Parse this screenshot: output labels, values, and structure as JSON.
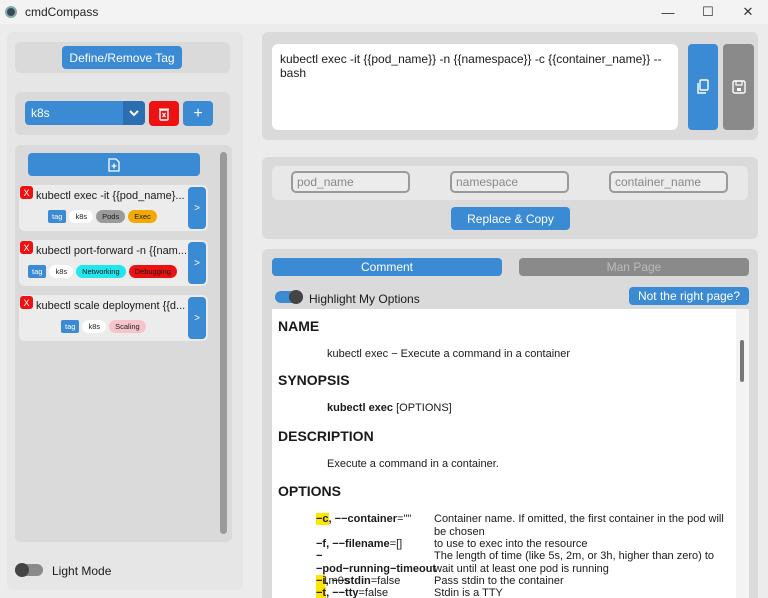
{
  "window": {
    "title": "cmdCompass",
    "minimize": "—",
    "maximize": "☐",
    "close": "✕"
  },
  "left": {
    "define_label": "Define/Remove Tag",
    "selected_tag": "k8s",
    "add_label": "+",
    "commands": [
      {
        "x": "X",
        "text": "kubectl exec -it {{pod_name}...",
        "open": ">",
        "tags": [
          {
            "label": "tag",
            "style": "label"
          },
          {
            "label": "k8s",
            "bg": "#ffffff",
            "fg": "#333333"
          },
          {
            "label": "Pods",
            "bg": "#9a9a9a",
            "fg": "#222222"
          },
          {
            "label": "Exec",
            "bg": "#f2a900",
            "fg": "#222222"
          }
        ]
      },
      {
        "x": "X",
        "text": "kubectl port-forward -n {{nam...",
        "open": ">",
        "tags": [
          {
            "label": "tag",
            "style": "label"
          },
          {
            "label": "k8s",
            "bg": "#ffffff",
            "fg": "#333333"
          },
          {
            "label": "Networking",
            "bg": "#22e5ee",
            "fg": "#222222"
          },
          {
            "label": "Debugging",
            "bg": "#ee1111",
            "fg": "#222222"
          }
        ]
      },
      {
        "x": "X",
        "text": "kubectl scale deployment {{d...",
        "open": ">",
        "tags": [
          {
            "label": "tag",
            "style": "label"
          },
          {
            "label": "k8s",
            "bg": "#ffffff",
            "fg": "#333333"
          },
          {
            "label": "Scaling",
            "bg": "#f8c4cc",
            "fg": "#333333"
          }
        ]
      }
    ],
    "light_mode_label": "Light Mode"
  },
  "command_text": "kubectl exec -it {{pod_name}} -n {{namespace}} -c {{container_name}} -- bash",
  "params": [
    {
      "placeholder": "pod_name"
    },
    {
      "placeholder": "namespace"
    },
    {
      "placeholder": "container_name"
    }
  ],
  "replace_label": "Replace & Copy",
  "tabs": {
    "comment": "Comment",
    "man": "Man Page"
  },
  "highlight_label": "Highlight My Options",
  "not_right_label": "Not the right page?",
  "man": {
    "name_h": "NAME",
    "name_text": "kubectl exec − Execute a command in a container",
    "synopsis_h": "SYNOPSIS",
    "synopsis_cmd": "kubectl exec",
    "synopsis_rest": " [OPTIONS]",
    "description_h": "DESCRIPTION",
    "description_text": "Execute a command in a container.",
    "options_h": "OPTIONS",
    "options": [
      {
        "hl": "−c",
        "flag": ", −−container",
        "def": "=\"\"",
        "desc": "Container name. If omitted, the first container in the pod will be chosen"
      },
      {
        "hl": "",
        "flag": "−f, −−filename",
        "def": "=[]",
        "desc": "to use to exec into the resource"
      },
      {
        "hl": "",
        "flag": "−−pod−running−timeout",
        "def": "=1m0s",
        "desc": "The length of time (like 5s, 2m, or 3h, higher than zero) to wait until at least one pod is running"
      },
      {
        "hl": "−i",
        "flag": ", −−stdin",
        "def": "=false",
        "desc": "Pass stdin to the container"
      },
      {
        "hl": "−t",
        "flag": ", −−tty",
        "def": "=false",
        "desc": "Stdin is a TTY"
      }
    ]
  }
}
